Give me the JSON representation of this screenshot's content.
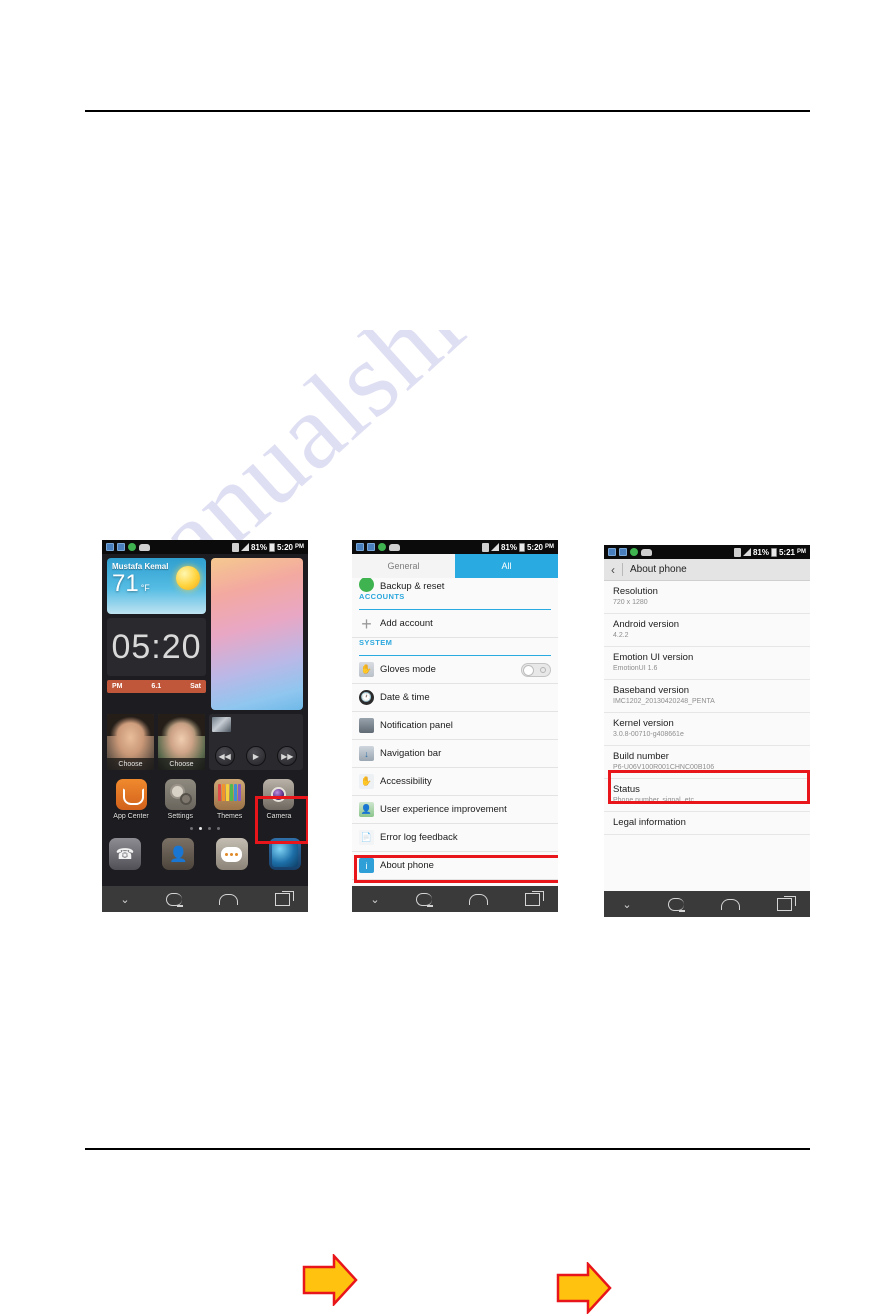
{
  "watermark": {
    "text": "manualshive.com"
  },
  "figure": {
    "arrows": [
      {
        "name": "arrow-home-to-settings",
        "direction": "right"
      },
      {
        "name": "arrow-settings-to-about",
        "direction": "right"
      }
    ]
  },
  "phone_home": {
    "status": {
      "battery": "81%",
      "time": "5:20",
      "ampm": "PM"
    },
    "weather": {
      "city": "Mustafa Kemal",
      "temp": "71",
      "unit": "°F"
    },
    "clock": {
      "time": "05:20",
      "ampm": "PM",
      "date": "6.1",
      "day": "Sat"
    },
    "photos": [
      {
        "label": "Choose"
      },
      {
        "label": "Choose"
      }
    ],
    "player": {
      "prev": "◀◀",
      "play": "▶",
      "next": "▶▶"
    },
    "apps": [
      {
        "label": "App Center",
        "icon": "app-center-icon"
      },
      {
        "label": "Settings",
        "icon": "settings-gear-icon",
        "highlighted": true
      },
      {
        "label": "Themes",
        "icon": "themes-pencils-icon"
      },
      {
        "label": "Camera",
        "icon": "camera-icon"
      }
    ],
    "page_dots": {
      "count": 4,
      "active_index": 1
    },
    "dock": [
      {
        "icon": "phone-dialer-icon"
      },
      {
        "icon": "contacts-icon"
      },
      {
        "icon": "messaging-icon"
      },
      {
        "icon": "browser-globe-icon"
      }
    ]
  },
  "phone_settings": {
    "status": {
      "battery": "81%",
      "time": "5:20",
      "ampm": "PM"
    },
    "tabs": [
      {
        "label": "General",
        "active": false
      },
      {
        "label": "All",
        "active": true
      }
    ],
    "items": [
      {
        "label": "Backup & reset",
        "icon": "backup-reset-icon",
        "type": "clipped"
      },
      {
        "label": "ACCOUNTS",
        "type": "section"
      },
      {
        "label": "Add account",
        "icon": "add-account-plus-icon",
        "type": "row"
      },
      {
        "label": "SYSTEM",
        "type": "section"
      },
      {
        "label": "Gloves mode",
        "icon": "gloves-mode-icon",
        "type": "toggle",
        "toggle_state": "off"
      },
      {
        "label": "Date & time",
        "icon": "date-time-icon",
        "type": "row"
      },
      {
        "label": "Notification panel",
        "icon": "notification-panel-icon",
        "type": "row"
      },
      {
        "label": "Navigation bar",
        "icon": "navigation-bar-icon",
        "type": "row"
      },
      {
        "label": "Accessibility",
        "icon": "accessibility-icon",
        "type": "row"
      },
      {
        "label": "User experience improvement",
        "icon": "user-experience-icon",
        "type": "row"
      },
      {
        "label": "Error log feedback",
        "icon": "error-log-icon",
        "type": "row"
      },
      {
        "label": "About phone",
        "icon": "about-phone-icon",
        "type": "row",
        "highlighted": true
      }
    ]
  },
  "phone_about": {
    "status": {
      "battery": "81%",
      "time": "5:21",
      "ampm": "PM"
    },
    "title": "About phone",
    "back_icon": "back-chevron-icon",
    "items": [
      {
        "title": "Resolution",
        "subtitle": "720 x 1280"
      },
      {
        "title": "Android version",
        "subtitle": "4.2.2"
      },
      {
        "title": "Emotion UI version",
        "subtitle": "EmotionUI 1.6"
      },
      {
        "title": "Baseband version",
        "subtitle": "IMC1202_20130420248_PENTA"
      },
      {
        "title": "Kernel version",
        "subtitle": "3.0.8-00710-g408661e"
      },
      {
        "title": "Build number",
        "subtitle": "P6-U06V100R001CHNC00B106",
        "highlighted": true
      },
      {
        "title": "Status",
        "subtitle": "Phone number, signal, etc."
      },
      {
        "title": "Legal information",
        "subtitle": ""
      }
    ]
  },
  "colors": {
    "highlight": "#e8161b",
    "accent_blue": "#29abe2",
    "arrow_fill": "#ffc20e",
    "arrow_stroke": "#e8161b"
  }
}
